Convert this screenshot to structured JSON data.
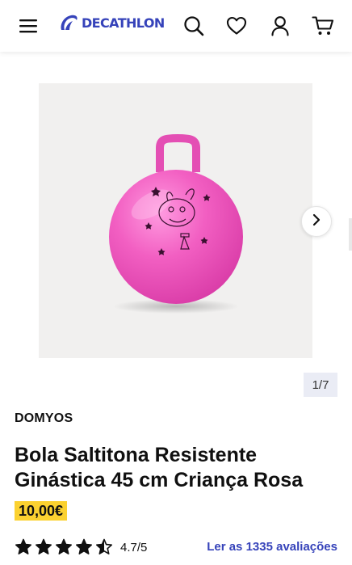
{
  "header": {
    "logo_text": "DECATHLON",
    "menu_icon": "hamburger-icon",
    "search_icon": "search-icon",
    "wishlist_icon": "heart-icon",
    "account_icon": "user-icon",
    "cart_icon": "cart-icon"
  },
  "gallery": {
    "counter": "1/7",
    "next_icon": "chevron-right-icon",
    "background_color": "#f1f0ef",
    "product_color": "#f05bbd"
  },
  "product": {
    "brand": "DOMYOS",
    "title": "Bola Saltitona Resistente Ginástica 45 cm Criança Rosa",
    "price": "10,00€",
    "rating": {
      "value": 4.7,
      "label": "4.7/5",
      "max": 5,
      "reviews_link": "Ler as 1335 avaliações"
    }
  },
  "colors": {
    "brand_blue": "#3643ba",
    "price_yellow": "#fbd130",
    "counter_bg": "#eaecf5"
  }
}
